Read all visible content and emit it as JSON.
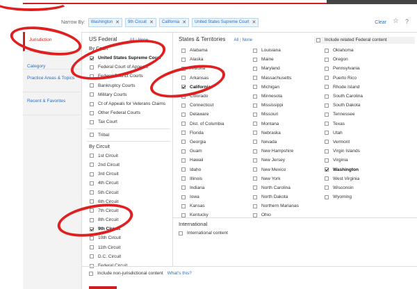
{
  "narrow": {
    "label": "Narrow By:",
    "chips": [
      "Washington",
      "9th Circuit",
      "California",
      "United States Supreme Court"
    ],
    "clear_label": "Clear",
    "star_icon": "☆",
    "help_icon": "?"
  },
  "sidebar": {
    "items": [
      "Jurisdiction",
      "Category",
      "Practice Areas & Topics",
      "Recent & Favorites"
    ]
  },
  "federal": {
    "title": "US Federal",
    "all": "All",
    "none": "None",
    "by_court_title": "By Court",
    "courts": [
      {
        "label": "United States Supreme Court",
        "checked": true
      },
      {
        "label": "Federal Court of Appeals",
        "checked": false
      },
      {
        "label": "Federal District Courts",
        "checked": false
      },
      {
        "label": "Bankruptcy Courts",
        "checked": false
      },
      {
        "label": "Military Courts",
        "checked": false
      },
      {
        "label": "Ct of Appeals for Veterans Claims",
        "checked": false
      },
      {
        "label": "Other Federal Courts",
        "checked": false
      },
      {
        "label": "Tax Court",
        "checked": false
      }
    ],
    "tribal": "Tribal",
    "by_circuit_title": "By Circuit",
    "circuits": [
      {
        "label": "1st Circuit",
        "checked": false
      },
      {
        "label": "2nd Circuit",
        "checked": false
      },
      {
        "label": "3rd Circuit",
        "checked": false
      },
      {
        "label": "4th Circuit",
        "checked": false
      },
      {
        "label": "5th Circuit",
        "checked": false
      },
      {
        "label": "6th Circuit",
        "checked": false
      },
      {
        "label": "7th Circuit",
        "checked": false
      },
      {
        "label": "8th Circuit",
        "checked": false
      },
      {
        "label": "9th Circuit",
        "checked": true
      },
      {
        "label": "10th Circuit",
        "checked": false
      },
      {
        "label": "11th Circuit",
        "checked": false
      },
      {
        "label": "D.C. Circuit",
        "checked": false
      },
      {
        "label": "Federal Circuit",
        "checked": false
      }
    ]
  },
  "states": {
    "title": "States & Territories",
    "all": "All",
    "none": "None",
    "related_label": "Include related Federal content",
    "columns": [
      [
        {
          "label": "Alabama",
          "checked": false
        },
        {
          "label": "Alaska",
          "checked": false
        },
        {
          "label": "Arizona",
          "checked": false
        },
        {
          "label": "Arkansas",
          "checked": false
        },
        {
          "label": "California",
          "checked": true
        },
        {
          "label": "Colorado",
          "checked": false
        },
        {
          "label": "Connecticut",
          "checked": false
        },
        {
          "label": "Delaware",
          "checked": false
        },
        {
          "label": "Dist. of Columbia",
          "checked": false
        },
        {
          "label": "Florida",
          "checked": false
        },
        {
          "label": "Georgia",
          "checked": false
        },
        {
          "label": "Guam",
          "checked": false
        },
        {
          "label": "Hawaii",
          "checked": false
        },
        {
          "label": "Idaho",
          "checked": false
        },
        {
          "label": "Illinois",
          "checked": false
        },
        {
          "label": "Indiana",
          "checked": false
        },
        {
          "label": "Iowa",
          "checked": false
        },
        {
          "label": "Kansas",
          "checked": false
        },
        {
          "label": "Kentucky",
          "checked": false
        }
      ],
      [
        {
          "label": "Louisiana",
          "checked": false
        },
        {
          "label": "Maine",
          "checked": false
        },
        {
          "label": "Maryland",
          "checked": false
        },
        {
          "label": "Massachusetts",
          "checked": false
        },
        {
          "label": "Michigan",
          "checked": false
        },
        {
          "label": "Minnesota",
          "checked": false
        },
        {
          "label": "Mississippi",
          "checked": false
        },
        {
          "label": "Missouri",
          "checked": false
        },
        {
          "label": "Montana",
          "checked": false
        },
        {
          "label": "Nebraska",
          "checked": false
        },
        {
          "label": "Nevada",
          "checked": false
        },
        {
          "label": "New Hampshire",
          "checked": false
        },
        {
          "label": "New Jersey",
          "checked": false
        },
        {
          "label": "New Mexico",
          "checked": false
        },
        {
          "label": "New York",
          "checked": false
        },
        {
          "label": "North Carolina",
          "checked": false
        },
        {
          "label": "North Dakota",
          "checked": false
        },
        {
          "label": "Northern Marianas",
          "checked": false
        },
        {
          "label": "Ohio",
          "checked": false
        }
      ],
      [
        {
          "label": "Oklahoma",
          "checked": false
        },
        {
          "label": "Oregon",
          "checked": false
        },
        {
          "label": "Pennsylvania",
          "checked": false
        },
        {
          "label": "Puerto Rico",
          "checked": false
        },
        {
          "label": "Rhode Island",
          "checked": false
        },
        {
          "label": "South Carolina",
          "checked": false
        },
        {
          "label": "South Dakota",
          "checked": false
        },
        {
          "label": "Tennessee",
          "checked": false
        },
        {
          "label": "Texas",
          "checked": false
        },
        {
          "label": "Utah",
          "checked": false
        },
        {
          "label": "Vermont",
          "checked": false
        },
        {
          "label": "Virgin Islands",
          "checked": false
        },
        {
          "label": "Virginia",
          "checked": false
        },
        {
          "label": "Washington",
          "checked": true
        },
        {
          "label": "West Virginia",
          "checked": false
        },
        {
          "label": "Wisconsin",
          "checked": false
        },
        {
          "label": "Wyoming",
          "checked": false
        }
      ]
    ]
  },
  "international": {
    "title": "International",
    "content_label": "International content"
  },
  "footer": {
    "nonjur_label": "Include non-jurisdictional content",
    "whats_this": "What's this?"
  }
}
